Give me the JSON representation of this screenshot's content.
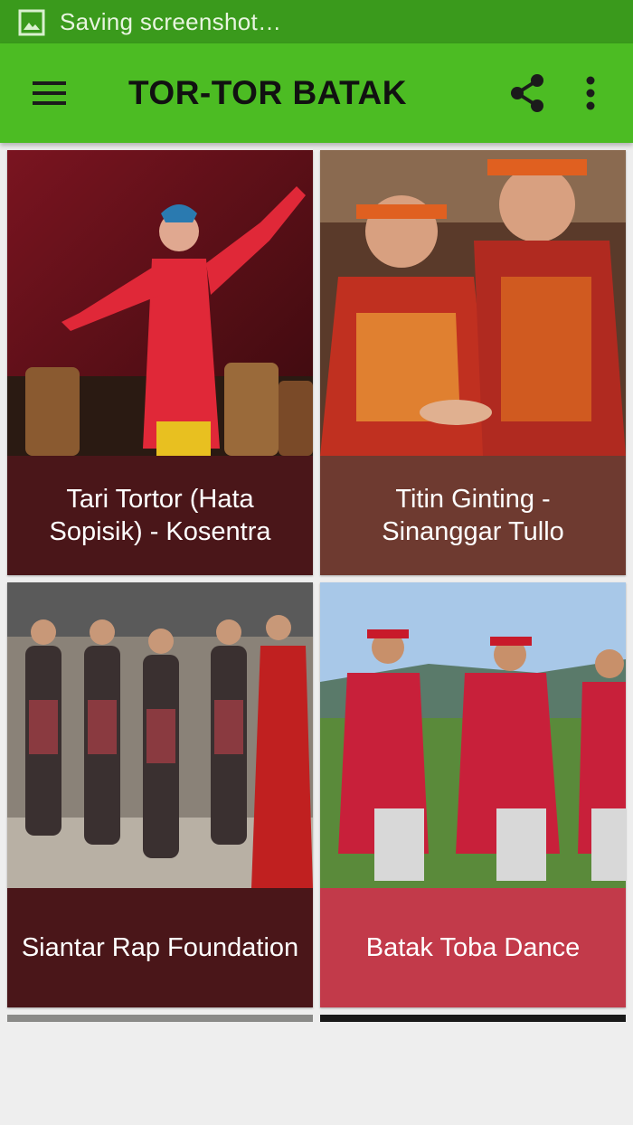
{
  "status_bar": {
    "notification_text": "Saving screenshot…",
    "icon": "image-icon"
  },
  "app_bar": {
    "title": "TOR-TOR BATAK",
    "menu_icon": "hamburger-menu-icon",
    "share_icon": "share-icon",
    "more_icon": "more-vert-icon"
  },
  "videos": [
    {
      "title": "Tari Tortor (Hata Sopisik) - Kosentra",
      "caption_color": "#4a1619"
    },
    {
      "title": "Titin Ginting - Sinanggar Tullo",
      "caption_color": "#6e3a30"
    },
    {
      "title": "Siantar Rap Foundation",
      "caption_color": "#4a1619"
    },
    {
      "title": "Batak Toba Dance",
      "caption_color": "#c23a4a"
    }
  ],
  "colors": {
    "status_bar": "#3a9a1c",
    "app_bar": "#4cbc23",
    "background": "#eeeeee"
  }
}
